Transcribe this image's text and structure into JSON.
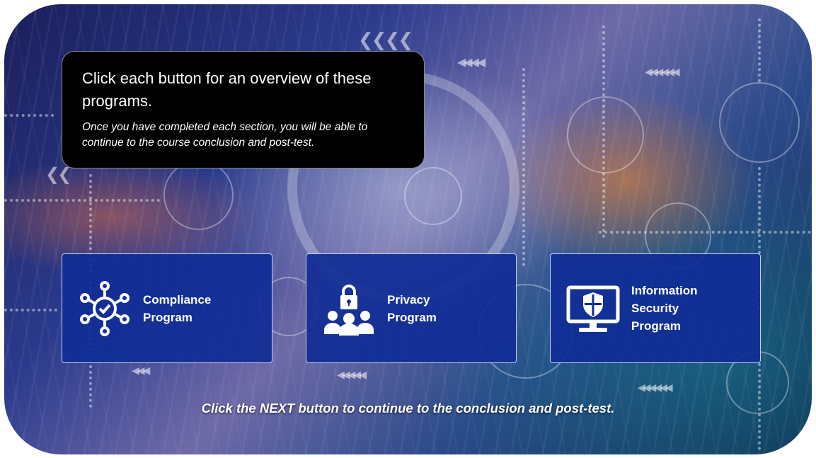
{
  "intro": {
    "title": "Click each button for an overview of these programs.",
    "subtitle": "Once you have completed each section, you will be able to continue to the course conclusion and post-test."
  },
  "program_buttons": [
    {
      "label": "Compliance\nProgram",
      "icon": "compliance-network-icon"
    },
    {
      "label": "Privacy\nProgram",
      "icon": "privacy-lock-people-icon"
    },
    {
      "label": "Information\nSecurity\nProgram",
      "icon": "security-monitor-shield-icon"
    }
  ],
  "footer": {
    "instruction": "Click the NEXT button to continue to the conclusion and post-test."
  },
  "colors": {
    "button_fill": "#102c96",
    "intro_box": "#000000",
    "text": "#ffffff"
  }
}
